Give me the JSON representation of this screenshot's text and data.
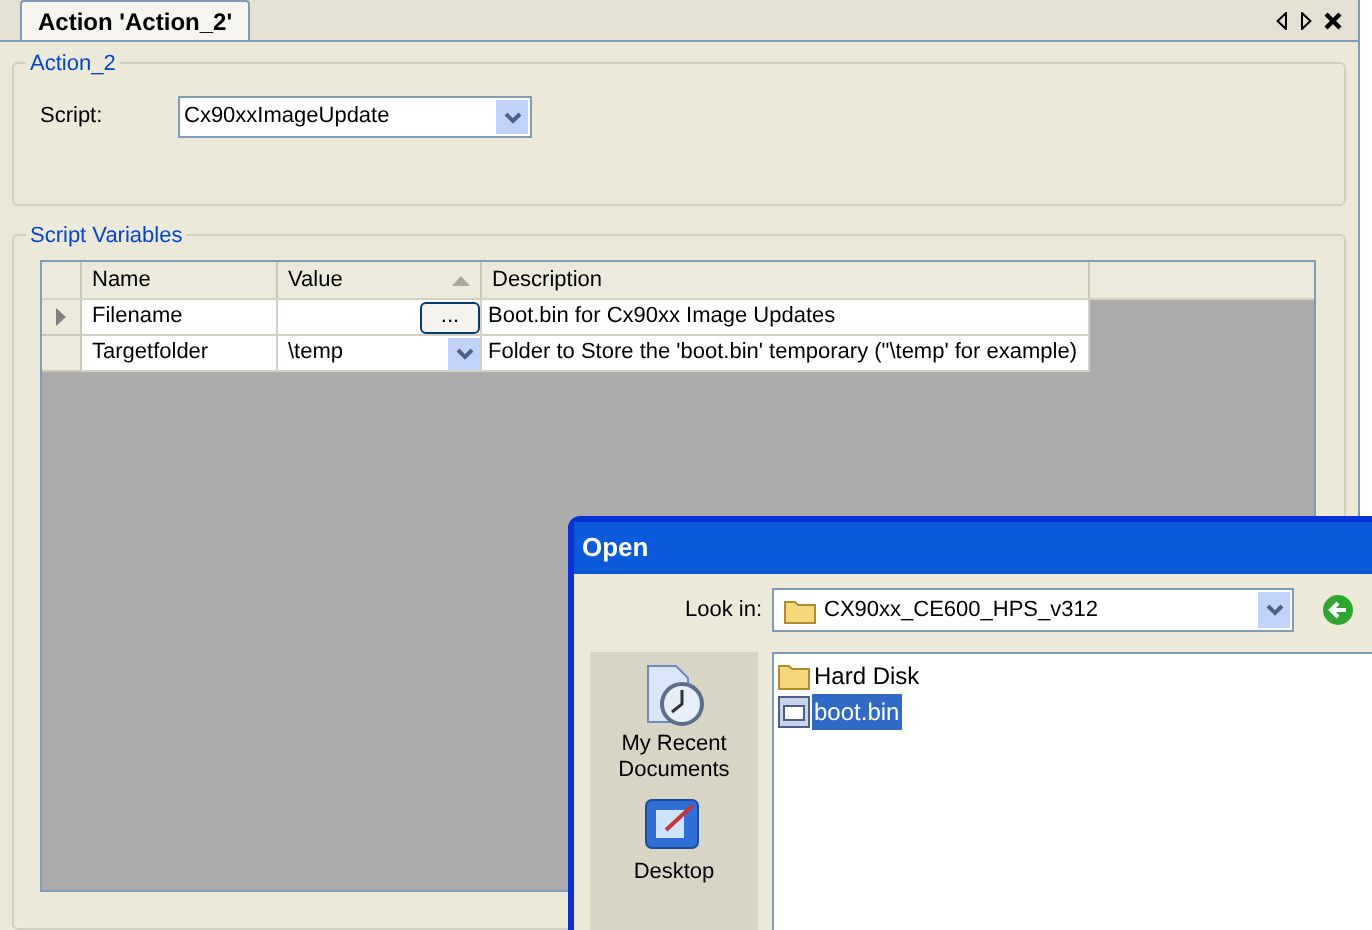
{
  "tab": {
    "title": "Action 'Action_2'",
    "selected": true
  },
  "action_group": {
    "title": "Action_2",
    "script_label": "Script:",
    "script_value": "Cx90xxImageUpdate"
  },
  "variables_group": {
    "title": "Script Variables",
    "columns": [
      {
        "label": "Name",
        "sorted": false
      },
      {
        "label": "Value",
        "sorted": true
      },
      {
        "label": "Description",
        "sorted": false
      }
    ],
    "rows": [
      {
        "selected": true,
        "name": "Filename",
        "kind": "browse",
        "button_label": "...",
        "description": "Boot.bin for Cx90xx Image Updates"
      },
      {
        "selected": false,
        "name": "Targetfolder",
        "kind": "dropdown",
        "value": "\\temp",
        "description": "Folder to Store the 'boot.bin' temporary (\"\\temp' for example)"
      }
    ]
  },
  "open_dialog": {
    "title": "Open",
    "look_in_label": "Look in:",
    "look_in_value": "CX90xx_CE600_HPS_v312",
    "places": [
      {
        "label": "My Recent Documents",
        "kind": "recent"
      },
      {
        "label": "Desktop",
        "kind": "desktop"
      }
    ],
    "files": [
      {
        "name": "Hard Disk",
        "kind": "folder",
        "selected": false
      },
      {
        "name": "boot.bin",
        "kind": "file",
        "selected": true
      }
    ]
  }
}
